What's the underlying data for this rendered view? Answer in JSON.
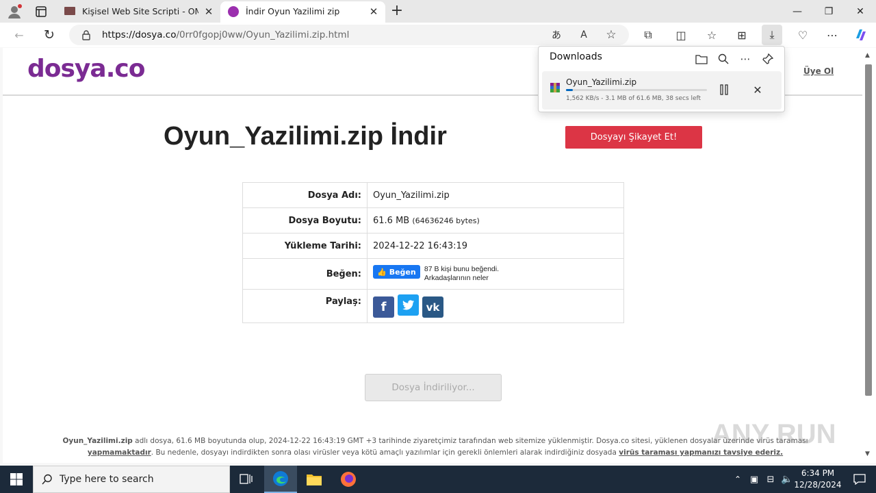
{
  "tabs": [
    {
      "title": "Kişisel Web Site Scripti - OM Pers",
      "active": false
    },
    {
      "title": "İndir Oyun Yazilimi zip",
      "active": true
    }
  ],
  "toolbar": {
    "url_domain": "https://dosya.co",
    "url_path": "/0rr0fgopj0ww/Oyun_Yazilimi.zip.html"
  },
  "site": {
    "logo": "dosya.co",
    "signup": "Üye Ol"
  },
  "main": {
    "title": "Oyun_Yazilimi.zip İndir",
    "report_button": "Dosyayı Şikayet Et!",
    "rows": {
      "name_label": "Dosya Adı:",
      "name_value": "Oyun_Yazilimi.zip",
      "size_label": "Dosya Boyutu:",
      "size_value": "61.6 MB",
      "size_bytes": "(64636246 bytes)",
      "date_label": "Yükleme Tarihi:",
      "date_value": "2024-12-22 16:43:19",
      "like_label": "Beğen:",
      "like_button": "Beğen",
      "like_text1": "87 B kişi bunu beğendi.",
      "like_text2": "Arkadaşlarının neler",
      "share_label": "Paylaş:"
    },
    "download_button": "Dosya İndiriliyor...",
    "footnote": {
      "filename": "Oyun_Yazilimi.zip",
      "text1": " adlı dosya, 61.6 MB boyutunda olup, 2024-12-22 16:43:19 GMT +3 tarihinde ziyaretçimiz tarafından web sitemize yüklenmiştir. Dosya.co sitesi, yüklenen dosyalar üzerinde virüs taraması ",
      "link1": "yapmamaktadır",
      "text2": ". Bu nedenle, dosyayı indirdikten sonra olası virüsler veya kötü amaçlı yazılımlar için gerekli önlemleri alarak indirdiğiniz dosyada ",
      "link2": "virüs taraması yapmanızı tavsiye ederiz."
    }
  },
  "downloads": {
    "header": "Downloads",
    "item_name": "Oyun_Yazilimi.zip",
    "status": "1,562 KB/s - 3.1 MB of 61.6 MB, 38 secs left",
    "progress_fraction": 0.05
  },
  "taskbar": {
    "search_placeholder": "Type here to search",
    "time": "6:34 PM",
    "date": "12/28/2024"
  },
  "watermark": "ANY RUN",
  "colors": {
    "brand": "#7b2b93",
    "report": "#dc3545",
    "facebook": "#3b5998",
    "twitter": "#1da1f2",
    "vk": "#2a5885"
  }
}
